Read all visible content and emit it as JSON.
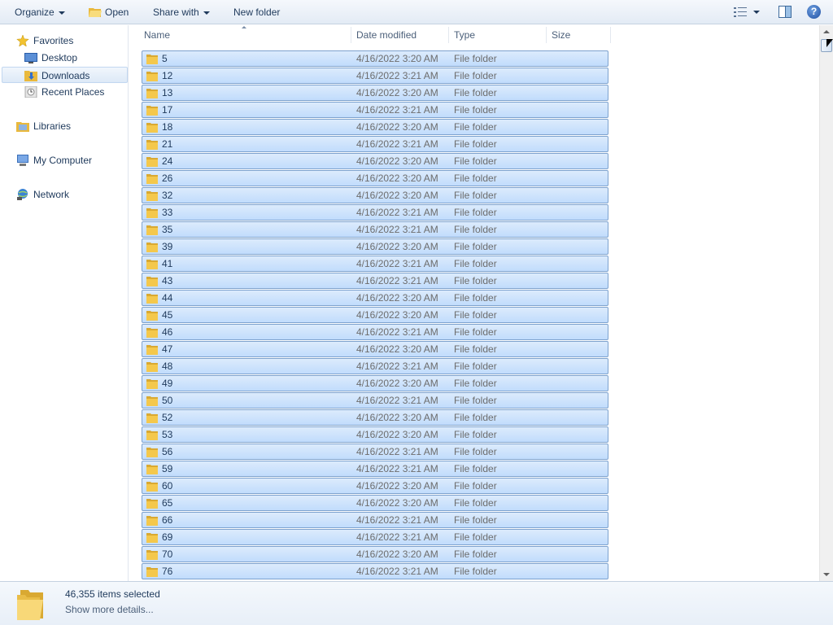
{
  "toolbar": {
    "organize_label": "Organize",
    "open_label": "Open",
    "share_label": "Share with",
    "new_folder_label": "New folder"
  },
  "nav": {
    "favorites": "Favorites",
    "desktop": "Desktop",
    "downloads": "Downloads",
    "recent": "Recent Places",
    "libraries": "Libraries",
    "computer": "My Computer",
    "network": "Network"
  },
  "columns": {
    "name": "Name",
    "date": "Date modified",
    "type": "Type",
    "size": "Size"
  },
  "files": [
    {
      "name": "5",
      "date": "4/16/2022 3:20 AM",
      "type": "File folder"
    },
    {
      "name": "12",
      "date": "4/16/2022 3:21 AM",
      "type": "File folder"
    },
    {
      "name": "13",
      "date": "4/16/2022 3:20 AM",
      "type": "File folder"
    },
    {
      "name": "17",
      "date": "4/16/2022 3:21 AM",
      "type": "File folder"
    },
    {
      "name": "18",
      "date": "4/16/2022 3:20 AM",
      "type": "File folder"
    },
    {
      "name": "21",
      "date": "4/16/2022 3:21 AM",
      "type": "File folder"
    },
    {
      "name": "24",
      "date": "4/16/2022 3:20 AM",
      "type": "File folder"
    },
    {
      "name": "26",
      "date": "4/16/2022 3:20 AM",
      "type": "File folder"
    },
    {
      "name": "32",
      "date": "4/16/2022 3:20 AM",
      "type": "File folder"
    },
    {
      "name": "33",
      "date": "4/16/2022 3:21 AM",
      "type": "File folder"
    },
    {
      "name": "35",
      "date": "4/16/2022 3:21 AM",
      "type": "File folder"
    },
    {
      "name": "39",
      "date": "4/16/2022 3:20 AM",
      "type": "File folder"
    },
    {
      "name": "41",
      "date": "4/16/2022 3:21 AM",
      "type": "File folder"
    },
    {
      "name": "43",
      "date": "4/16/2022 3:21 AM",
      "type": "File folder"
    },
    {
      "name": "44",
      "date": "4/16/2022 3:20 AM",
      "type": "File folder"
    },
    {
      "name": "45",
      "date": "4/16/2022 3:20 AM",
      "type": "File folder"
    },
    {
      "name": "46",
      "date": "4/16/2022 3:21 AM",
      "type": "File folder"
    },
    {
      "name": "47",
      "date": "4/16/2022 3:20 AM",
      "type": "File folder"
    },
    {
      "name": "48",
      "date": "4/16/2022 3:21 AM",
      "type": "File folder"
    },
    {
      "name": "49",
      "date": "4/16/2022 3:20 AM",
      "type": "File folder"
    },
    {
      "name": "50",
      "date": "4/16/2022 3:21 AM",
      "type": "File folder"
    },
    {
      "name": "52",
      "date": "4/16/2022 3:20 AM",
      "type": "File folder"
    },
    {
      "name": "53",
      "date": "4/16/2022 3:20 AM",
      "type": "File folder"
    },
    {
      "name": "56",
      "date": "4/16/2022 3:21 AM",
      "type": "File folder"
    },
    {
      "name": "59",
      "date": "4/16/2022 3:21 AM",
      "type": "File folder"
    },
    {
      "name": "60",
      "date": "4/16/2022 3:20 AM",
      "type": "File folder"
    },
    {
      "name": "65",
      "date": "4/16/2022 3:20 AM",
      "type": "File folder"
    },
    {
      "name": "66",
      "date": "4/16/2022 3:21 AM",
      "type": "File folder"
    },
    {
      "name": "69",
      "date": "4/16/2022 3:21 AM",
      "type": "File folder"
    },
    {
      "name": "70",
      "date": "4/16/2022 3:20 AM",
      "type": "File folder"
    },
    {
      "name": "76",
      "date": "4/16/2022 3:21 AM",
      "type": "File folder"
    }
  ],
  "details": {
    "count": "46,355 items selected",
    "more": "Show more details..."
  },
  "colors": {
    "row_selected": "#c9e0fc",
    "row_border": "#7da2ce",
    "text": "#1e395b",
    "folder": "#f4c84c"
  }
}
